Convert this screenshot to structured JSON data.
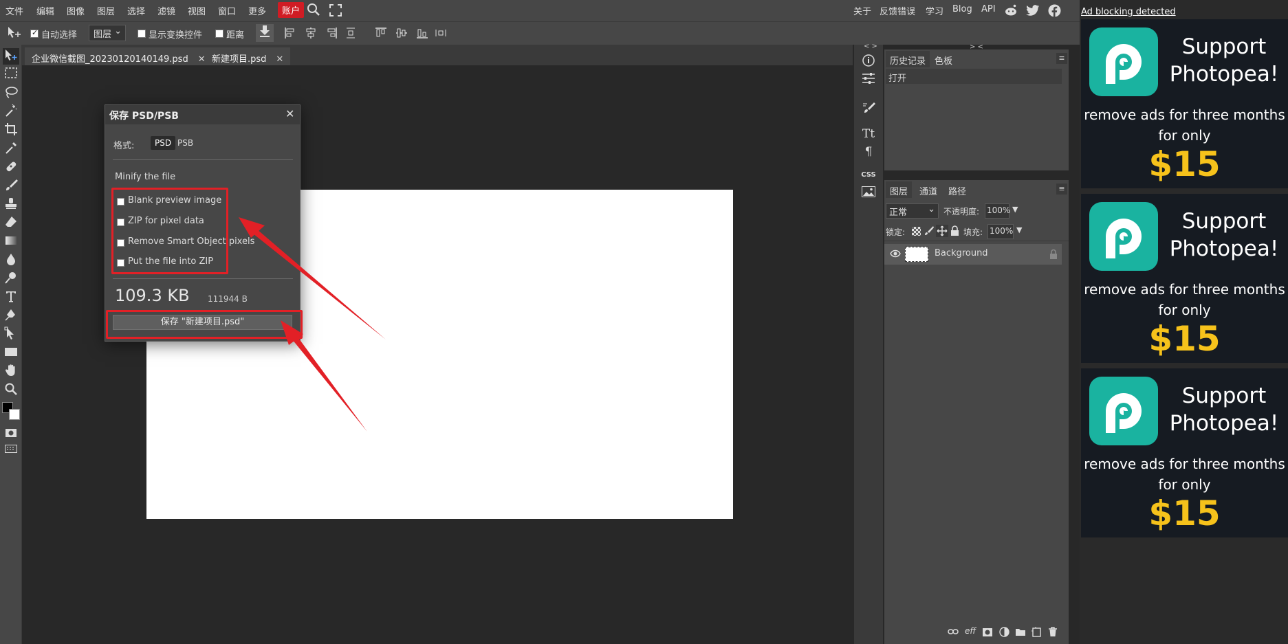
{
  "menubar": {
    "items": [
      "文件",
      "编辑",
      "图像",
      "图层",
      "选择",
      "滤镜",
      "视图",
      "窗口",
      "更多"
    ],
    "account": "账户",
    "links": [
      "关于",
      "反馈错误",
      "学习",
      "Blog",
      "API"
    ]
  },
  "optionsbar": {
    "auto_select_label": "自动选择",
    "layer_select_value": "图层",
    "show_transform_label": "显示变换控件",
    "distance_label": "距离"
  },
  "tabs": [
    {
      "label": "企业微信截图_20230120140149.psd",
      "close": "✕"
    },
    {
      "label": "新建项目.psd",
      "close": "✕"
    }
  ],
  "dialog": {
    "title": "保存 PSD/PSB",
    "close": "✕",
    "format_label": "格式:",
    "format_options": [
      "PSD",
      "PSB"
    ],
    "selected_format": "PSD",
    "minify_label": "Minify the file",
    "options": [
      "Blank preview image",
      "ZIP for pixel data",
      "Remove Smart Object pixels",
      "Put the file into ZIP"
    ],
    "size_text": "109.3 KB",
    "size_bytes": "111944 B",
    "save_label": "保存 \"新建项目.psd\""
  },
  "history_panel": {
    "tabs": [
      "历史记录",
      "色板"
    ],
    "entries": [
      "打开"
    ],
    "collapse_left": "< >",
    "collapse_right": "> <"
  },
  "layers_panel": {
    "tabs": [
      "图层",
      "通道",
      "路径"
    ],
    "blend_mode": "正常",
    "opacity_label": "不透明度:",
    "opacity_value": "100%",
    "lock_label": "锁定:",
    "fill_label": "填充:",
    "fill_value": "100%",
    "layers": [
      {
        "name": "Background",
        "visible": true,
        "locked": true
      }
    ],
    "footer_eff": "eff"
  },
  "ads": {
    "notice": "Ad blocking detected",
    "title": "Support Photopea!",
    "text": "remove ads for three months for only",
    "price": "$15"
  },
  "colors": {
    "accent_red": "#e22026",
    "ad_teal": "#1ab3a0",
    "ad_yellow": "#f6c21b"
  }
}
